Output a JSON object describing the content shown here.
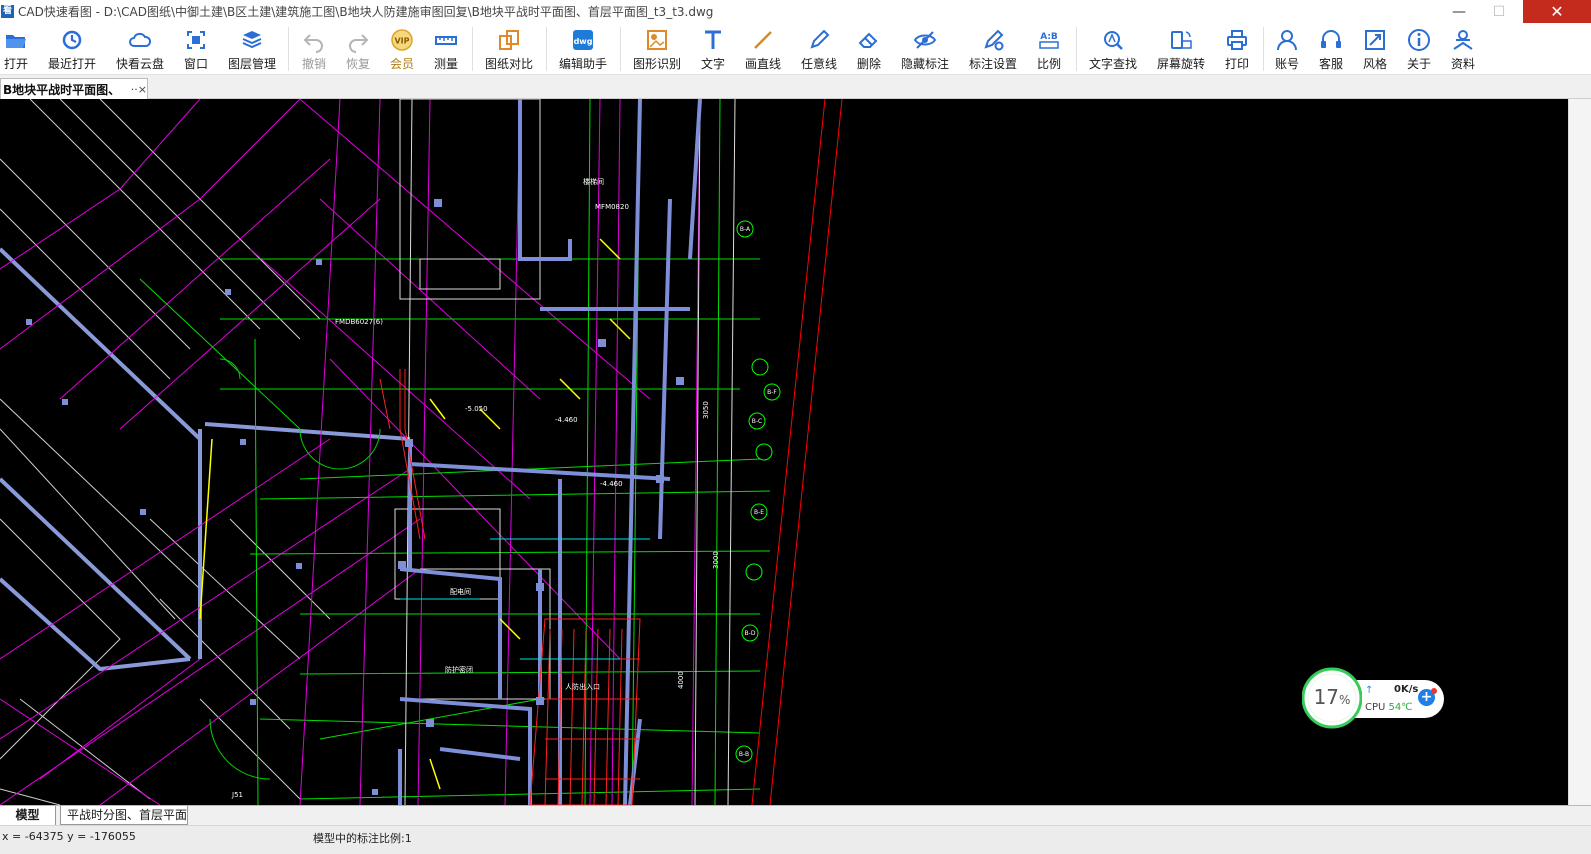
{
  "window": {
    "title": "CAD快速看图 - D:\\CAD图纸\\中御土建\\B区土建\\建筑施工图\\B地块人防建施审图回复\\B地块平战时平面图、首层平面图_t3_t3.dwg",
    "logo_text": "看",
    "min_glyph": "—",
    "max_glyph": "☐",
    "close_glyph": "✕"
  },
  "toolbar": {
    "items": [
      {
        "label": "打开",
        "icon": "folder-open-icon"
      },
      {
        "label": "最近打开",
        "icon": "history-icon"
      },
      {
        "label": "快看云盘",
        "icon": "cloud-icon"
      },
      {
        "label": "窗口",
        "icon": "window-focus-icon"
      },
      {
        "label": "图层管理",
        "icon": "layers-icon"
      },
      {
        "label": "撤销",
        "icon": "undo-icon",
        "disabled": true
      },
      {
        "label": "恢复",
        "icon": "redo-icon",
        "disabled": true
      },
      {
        "label": "会员",
        "icon": "vip-icon"
      },
      {
        "label": "测量",
        "icon": "ruler-icon"
      },
      {
        "label": "图纸对比",
        "icon": "compare-icon"
      },
      {
        "label": "编辑助手",
        "icon": "edit-assistant-icon"
      },
      {
        "label": "图形识别",
        "icon": "shape-recognize-icon"
      },
      {
        "label": "文字",
        "icon": "text-icon"
      },
      {
        "label": "画直线",
        "icon": "line-icon"
      },
      {
        "label": "任意线",
        "icon": "pen-icon"
      },
      {
        "label": "删除",
        "icon": "eraser-icon"
      },
      {
        "label": "隐藏标注",
        "icon": "hide-eye-icon"
      },
      {
        "label": "标注设置",
        "icon": "annotation-settings-icon"
      },
      {
        "label": "比例",
        "icon": "ratio-icon"
      },
      {
        "label": "文字查找",
        "icon": "text-search-icon"
      },
      {
        "label": "屏幕旋转",
        "icon": "rotate-screen-icon"
      },
      {
        "label": "打印",
        "icon": "printer-icon"
      },
      {
        "label": "账号",
        "icon": "user-icon"
      },
      {
        "label": "客服",
        "icon": "headset-icon"
      },
      {
        "label": "风格",
        "icon": "style-icon"
      },
      {
        "label": "关于",
        "icon": "info-icon"
      },
      {
        "label": "资料",
        "icon": "documents-icon"
      }
    ]
  },
  "doc_tab": {
    "label": "B地块平战时平面图、",
    "close_glyph": "··×"
  },
  "net_widget": {
    "cpu_percent": 17,
    "percent_sign": "%",
    "upload_arrow": "↑",
    "speed": "0K/s",
    "cpu_label": "CPU",
    "cpu_temp": "54℃",
    "add_glyph": "+"
  },
  "layout_tabs": {
    "model": "模型",
    "layout1": "平战时分图、首层平面"
  },
  "status": {
    "coords": "x = -64375  y = -176055",
    "scale": "模型中的标注比例:1"
  },
  "drawing_labels": {
    "fmdb": "FMDB6027(6)",
    "mfm": "MFM0820",
    "axis_b_a": "B-A",
    "axis_b_f": "B-F",
    "axis_b_e": "B-E",
    "axis_b_d": "B-D",
    "axis_b_c": "B-C",
    "axis_b_b": "B-B",
    "elev_1": "-5.050",
    "elev_2": "-4.460",
    "elev_3": "-4.460",
    "room_1": "楼梯间",
    "room_2": "配电间",
    "room_3": "防护密闭",
    "room_4": "人防出入口",
    "j51": "J51",
    "dim_1": "3050",
    "dim_2": "3000",
    "dim_3": "4000"
  },
  "colors": {
    "canvas_bg": "#000000",
    "cad_green": "#00ff00",
    "cad_magenta": "#ff00ff",
    "cad_red": "#ff0000",
    "cad_wall": "#7e8fd8",
    "cad_white": "#ffffff",
    "cad_yellow": "#ffff00",
    "cad_cyan": "#00ffff",
    "cpu_ring": "#33cc55",
    "close_red": "#c42b1c"
  }
}
